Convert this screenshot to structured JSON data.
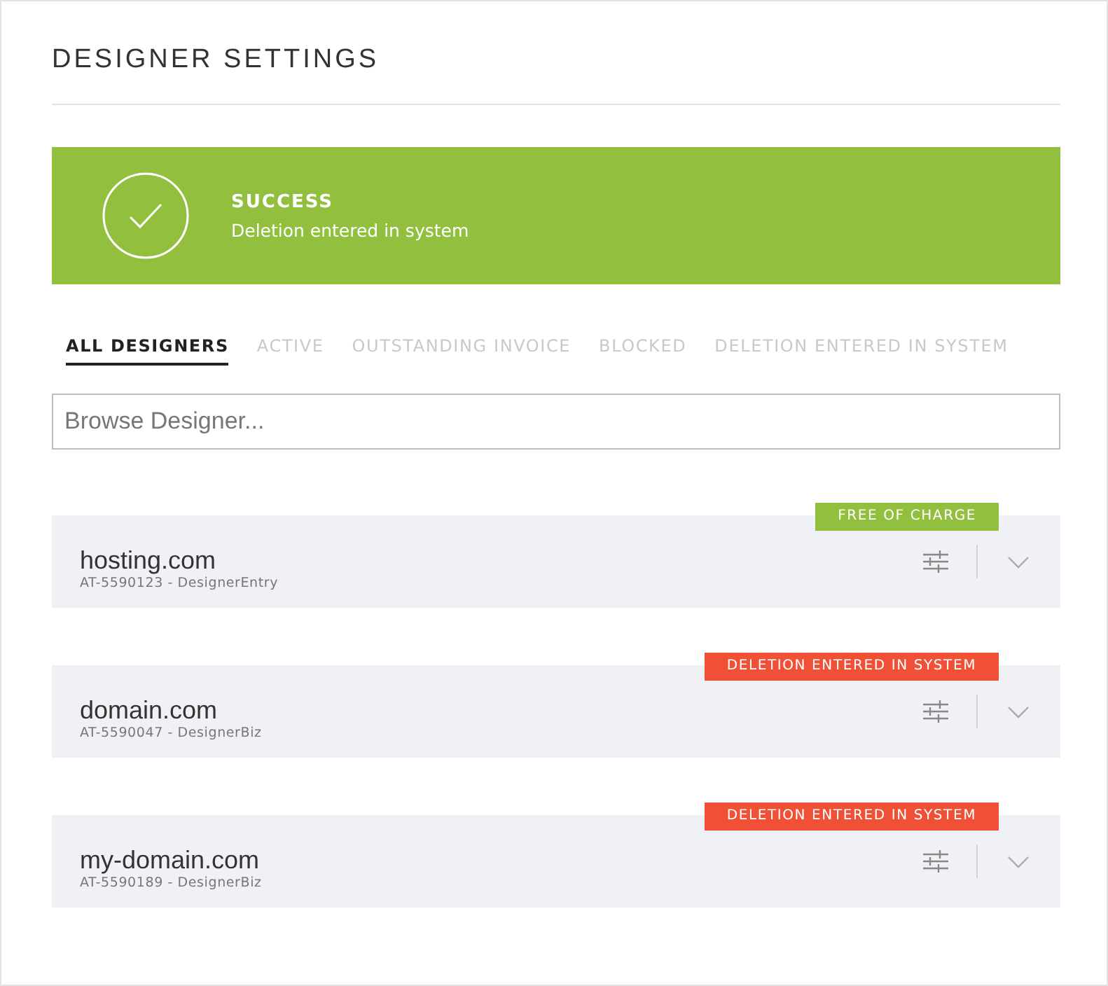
{
  "title": "DESIGNER SETTINGS",
  "alert": {
    "kind": "success",
    "heading": "SUCCESS",
    "message": "Deletion entered in system"
  },
  "tabs": [
    {
      "label": "ALL DESIGNERS",
      "selected": true
    },
    {
      "label": "ACTIVE",
      "selected": false
    },
    {
      "label": "OUTSTANDING INVOICE",
      "selected": false
    },
    {
      "label": "BLOCKED",
      "selected": false
    },
    {
      "label": "DELETION ENTERED IN SYSTEM",
      "selected": false
    }
  ],
  "search": {
    "placeholder": "Browse Designer..."
  },
  "designers": [
    {
      "name": "hosting.com",
      "detail": "AT-5590123 - DesignerEntry",
      "badge": {
        "text": "FREE OF CHARGE",
        "color": "#92c03e"
      }
    },
    {
      "name": "domain.com",
      "detail": "AT-5590047 - DesignerBiz",
      "badge": {
        "text": "DELETION ENTERED IN SYSTEM",
        "color": "#ef5036"
      }
    },
    {
      "name": "my-domain.com",
      "detail": "AT-5590189 - DesignerBiz",
      "badge": {
        "text": "DELETION ENTERED IN SYSTEM",
        "color": "#ef5036"
      }
    }
  ]
}
